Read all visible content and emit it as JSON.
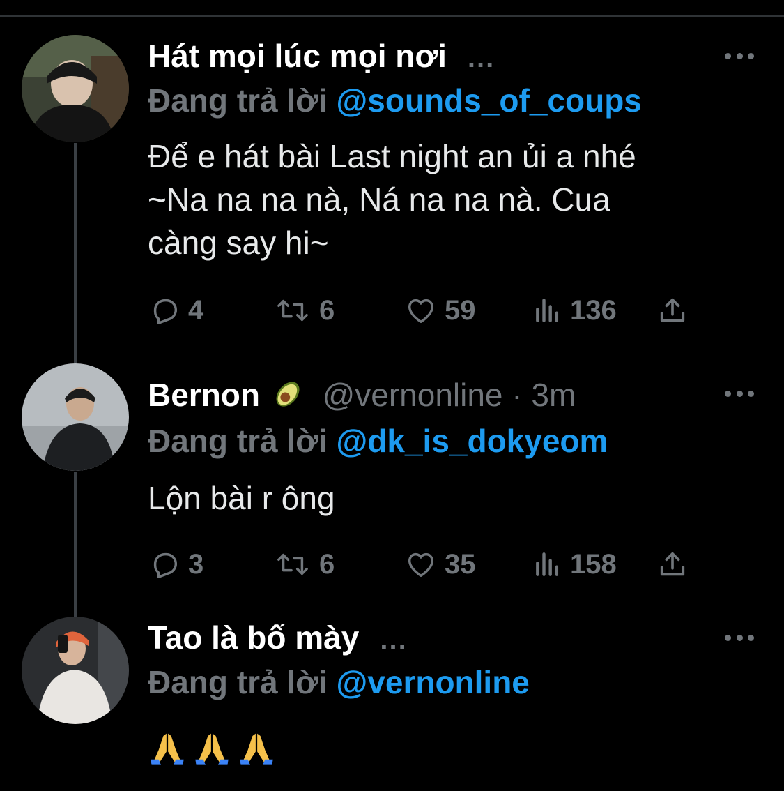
{
  "tweets": [
    {
      "display_name": "Hát mọi lúc mọi nơi",
      "name_ellipsis": "...",
      "reply_prefix": "Đang trả lời",
      "reply_to": "@sounds_of_coups",
      "text_lines": [
        "Để e hát bài Last night an ủi a nhé",
        "~Na na na nà, Ná na na nà. Cua",
        "càng say hi~"
      ],
      "reply_count": "4",
      "retweet_count": "6",
      "like_count": "59",
      "view_count": "136"
    },
    {
      "display_name": "Bernon",
      "name_emoji": "avocado",
      "handle_time": "@vernonline · 3m",
      "reply_prefix": "Đang trả lời",
      "reply_to": "@dk_is_dokyeom",
      "text_lines": [
        "Lộn bài r ông"
      ],
      "reply_count": "3",
      "retweet_count": "6",
      "like_count": "35",
      "view_count": "158"
    },
    {
      "display_name": "Tao là bố mày",
      "name_ellipsis": "...",
      "reply_prefix": "Đang trả lời",
      "reply_to": "@vernonline",
      "emojis": [
        "folded-hands",
        "folded-hands",
        "folded-hands"
      ]
    }
  ],
  "colors": {
    "background": "#000000",
    "secondary_text": "#71767b",
    "link": "#1d9bf0",
    "thread_line": "#3a3f44"
  },
  "icons": [
    "reply-icon",
    "retweet-icon",
    "like-icon",
    "views-icon",
    "share-icon",
    "more-icon",
    "avocado-icon",
    "folded-hands-icon"
  ]
}
